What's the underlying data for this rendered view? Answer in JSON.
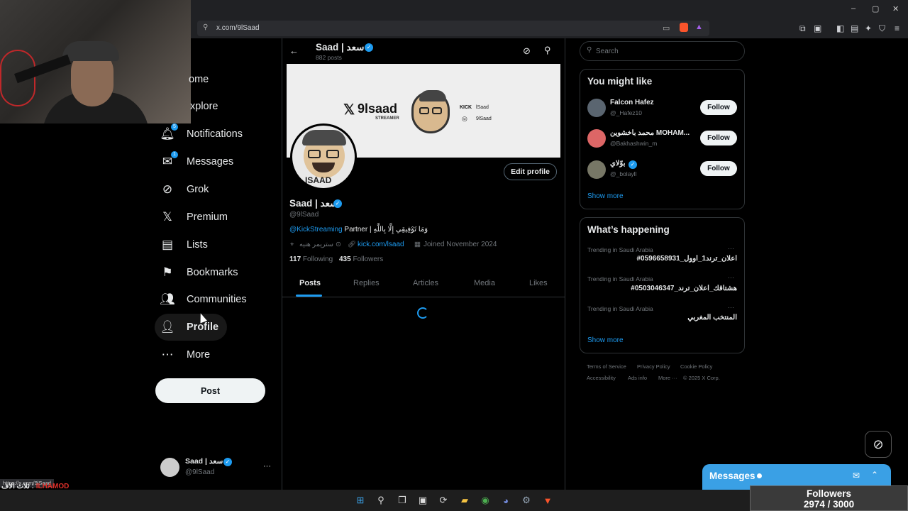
{
  "browser": {
    "url": "x.com/9lSaad",
    "window_controls": [
      "–",
      "▢",
      "✕"
    ]
  },
  "overlay": {
    "status_url": "https://x.com/9lSaad",
    "ticker_text": "ثلاث الاف :",
    "ticker_name": "ILHAMOD"
  },
  "nav": {
    "items": [
      {
        "label": "Home",
        "icon": "home-icon"
      },
      {
        "label": "Explore",
        "icon": "search-icon"
      },
      {
        "label": "Notifications",
        "icon": "bell-icon"
      },
      {
        "label": "Messages",
        "icon": "mail-icon"
      },
      {
        "label": "Grok",
        "icon": "grok-icon"
      },
      {
        "label": "Premium",
        "icon": "x-logo-icon"
      },
      {
        "label": "Lists",
        "icon": "list-icon"
      },
      {
        "label": "Bookmarks",
        "icon": "bookmark-icon"
      },
      {
        "label": "Communities",
        "icon": "communities-icon"
      },
      {
        "label": "Profile",
        "icon": "person-icon"
      },
      {
        "label": "More",
        "icon": "more-icon"
      }
    ],
    "home_visible": "ome",
    "explore_visible": "xplore",
    "notifications_badge": "5",
    "messages_badge": "1",
    "post_label": "Post",
    "account_name": "Saad | سعد",
    "account_handle": "@9lSaad",
    "account_more": "···"
  },
  "profile": {
    "header_name": "Saad | سعد",
    "posts_count": "882 posts",
    "banner_logo_text": "9lsaad",
    "banner_sub": "STREAMER",
    "banner_kick": "KICK",
    "banner_kick_user": "lSaad",
    "banner_ig_user": "9lSaad",
    "avatar_label": "ISAAD",
    "edit_button": "Edit profile",
    "name": "Saad | سعد",
    "handle": "@9lSaad",
    "bio_link": "@KickStreaming",
    "bio_rest": "Partner | وَمَا تَوْفِيقِي إِلَّا بِاللَّهِ",
    "location": "ستريمر هنيه",
    "website": "kick.com/lsaad",
    "joined": "Joined November 2024",
    "following_count": "117",
    "following_label": "Following",
    "followers_count": "435",
    "followers_label": "Followers",
    "tabs": [
      "Posts",
      "Replies",
      "Articles",
      "Media",
      "Likes"
    ]
  },
  "sidebar_right": {
    "search_placeholder": "Search",
    "might_like_title": "You might like",
    "suggestions": [
      {
        "name": "Falcon Hafez",
        "handle": "@_Hafez10",
        "button": "Follow"
      },
      {
        "name": "محمد باخشوين MOHAM...",
        "handle": "@Bakhashwin_m",
        "button": "Follow"
      },
      {
        "name": "بوّلاي",
        "handle": "@_bolayll",
        "button": "Follow"
      }
    ],
    "show_more": "Show more",
    "happening_title": "What’s happening",
    "trends": [
      {
        "context": "Trending in Saudi Arabia",
        "topic": "#اعلان_ترند1_اوول_0596658931"
      },
      {
        "context": "Trending in Saudi Arabia",
        "topic": "#هشتاقك_اعلان_ترند_0503046347"
      },
      {
        "context": "Trending in Saudi Arabia",
        "topic": "المنتخب المغربي"
      }
    ],
    "trend_more": "···",
    "footer_line1": [
      "Terms of Service",
      "Privacy Policy",
      "Cookie Policy"
    ],
    "footer_line2": [
      "Accessibility",
      "Ads info",
      "More ···",
      "© 2025 X Corp."
    ]
  },
  "messages_dock": {
    "label": "Messages"
  },
  "followers_goal": {
    "label": "Followers",
    "value": "2974 / 3000",
    "current": 2974,
    "goal": 3000
  },
  "colors": {
    "accent": "#1d9bf0",
    "background": "#000000",
    "border": "#2f3336"
  }
}
